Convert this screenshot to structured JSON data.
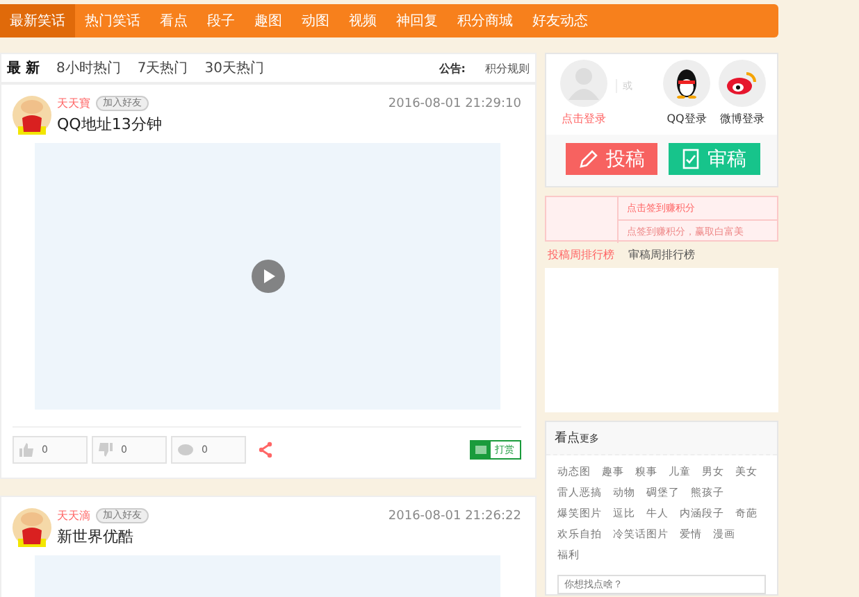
{
  "nav": [
    {
      "label": "最新笑话",
      "selected": true
    },
    {
      "label": "热门笑话",
      "selected": false
    },
    {
      "label": "看点",
      "selected": false
    },
    {
      "label": "段子",
      "selected": false
    },
    {
      "label": "趣图",
      "selected": false
    },
    {
      "label": "动图",
      "selected": false
    },
    {
      "label": "视频",
      "selected": false
    },
    {
      "label": "神回复",
      "selected": false
    },
    {
      "label": "积分商城",
      "selected": false
    },
    {
      "label": "好友动态",
      "selected": false
    }
  ],
  "sort_tabs": [
    {
      "label": "最 新",
      "selected": true
    },
    {
      "label": "8小时热门",
      "selected": false
    },
    {
      "label": "7天热门",
      "selected": false
    },
    {
      "label": "30天热门",
      "selected": false
    }
  ],
  "notice": {
    "label": "公告:",
    "link": "积分规则"
  },
  "posts": [
    {
      "author": "天天寶",
      "badge": "加入好友",
      "time": "2016-08-01 21:29:10",
      "title": "QQ地址13分钟",
      "likes": "0",
      "dislikes": "0",
      "comments": "0",
      "tip": "打赏"
    },
    {
      "author": "天天滴",
      "badge": "加入好友",
      "time": "2016-08-01 21:26:22",
      "title": "新世界优酷"
    }
  ],
  "login": {
    "prompt": "点击登录",
    "or": "或",
    "qq": "QQ登录",
    "weibo": "微博登录"
  },
  "actions": [
    {
      "label": "投稿",
      "kind": "submit"
    },
    {
      "label": "审稿",
      "kind": "review"
    }
  ],
  "signin": {
    "title": "点击签到赚积分",
    "subtitle": "点签到赚积分，赢取白富美"
  },
  "rank_tabs": [
    {
      "label": "投稿周排行榜",
      "selected": true
    },
    {
      "label": "审稿周排行榜",
      "selected": false
    }
  ],
  "more": {
    "title": "看点",
    "more": "更多",
    "tags": [
      "动态图",
      "趣事",
      "糗事",
      "儿童",
      "男女",
      "美女",
      "雷人恶搞",
      "动物",
      "碉堡了",
      "熊孩子",
      "爆笑图片",
      "逗比",
      "牛人",
      "内涵段子",
      "奇葩",
      "欢乐自拍",
      "冷笑话图片",
      "爱情",
      "漫画",
      "福利"
    ],
    "search_placeholder": "你想找点啥？"
  }
}
